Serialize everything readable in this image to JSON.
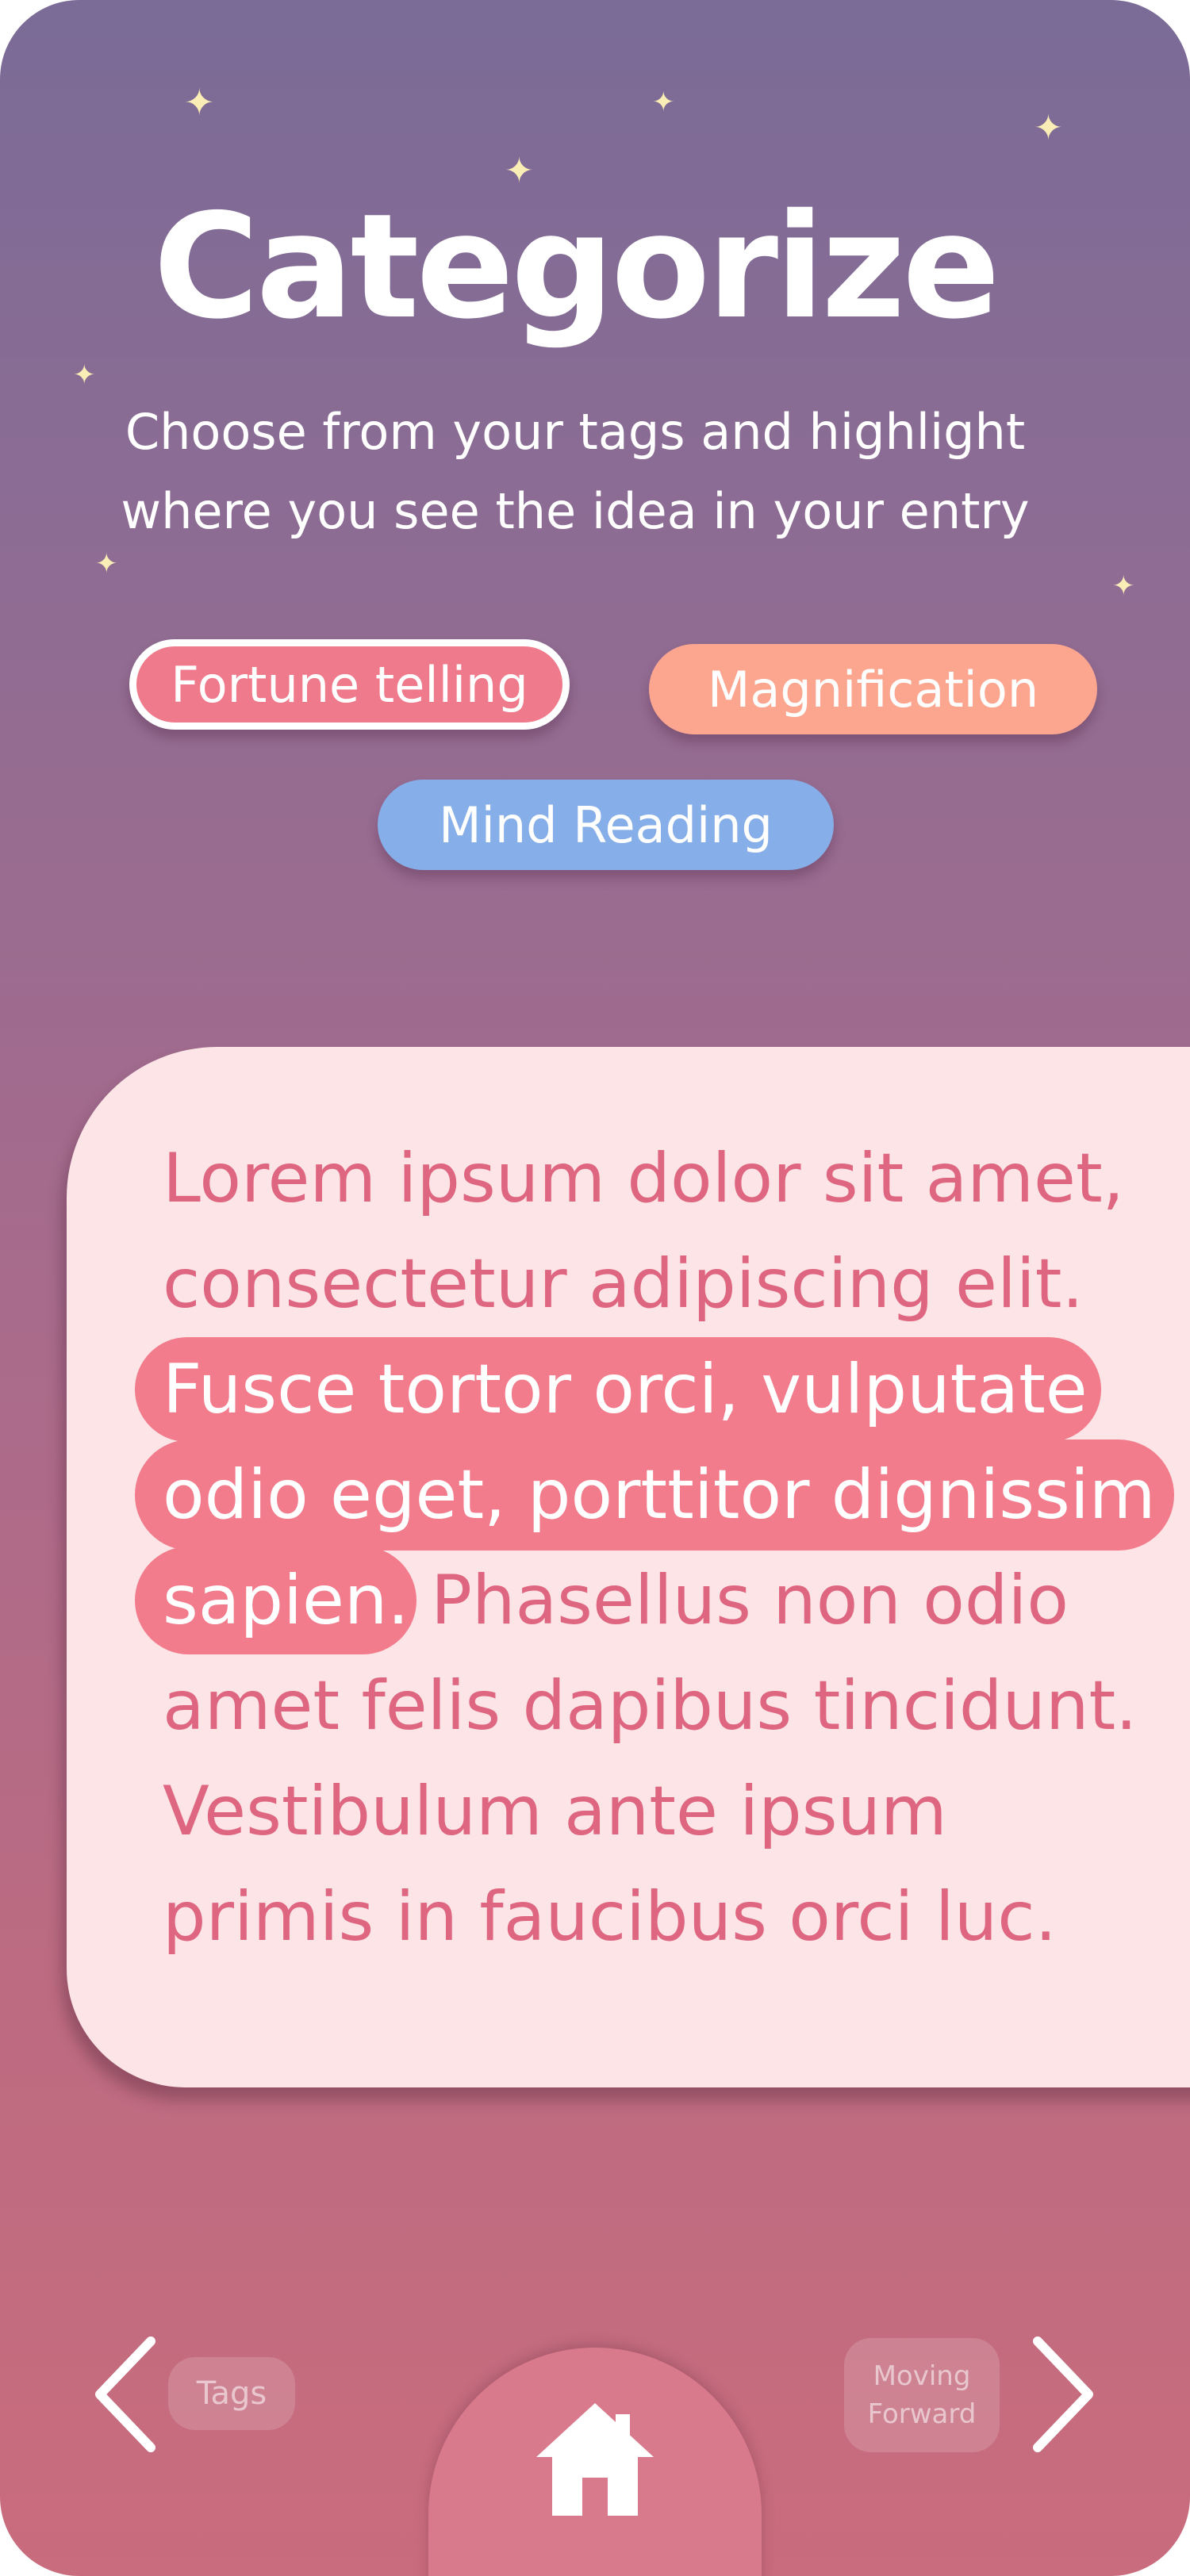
{
  "header": {
    "title": "Categorize",
    "subtitle_lines": [
      "Choose from your tags and highlight",
      "where you see the idea in your entry"
    ]
  },
  "tags": [
    {
      "label": "Fortune telling",
      "color": "#ef7a8b",
      "selected": true
    },
    {
      "label": "Magnification",
      "color": "#fca58f",
      "selected": false
    },
    {
      "label": "Mind Reading",
      "color": "#86aee8",
      "selected": false
    }
  ],
  "entry": {
    "lines": [
      {
        "before": "Lorem ipsum dolor sit amet,",
        "highlight": "",
        "after": ""
      },
      {
        "before": "consectetur adipiscing elit.",
        "highlight": "",
        "after": ""
      },
      {
        "before": "",
        "highlight": "Fusce tortor orci, vulputate",
        "after": ""
      },
      {
        "before": "",
        "highlight": "odio eget, porttitor dignissim",
        "after": ""
      },
      {
        "before": "",
        "highlight": "sapien.",
        "after": " Phasellus non odio"
      },
      {
        "before": "amet felis dapibus tincidunt.",
        "highlight": "",
        "after": ""
      },
      {
        "before": "Vestibulum ante ipsum",
        "highlight": "",
        "after": ""
      },
      {
        "before": "primis in faucibus orci luc.",
        "highlight": "",
        "after": ""
      }
    ],
    "highlight_color": "#f27b8c"
  },
  "nav": {
    "back_label": "Tags",
    "forward_label_lines": [
      "Moving",
      "Forward"
    ],
    "back_icon": "chevron-left-icon",
    "forward_icon": "chevron-right-icon",
    "home_icon": "home-icon"
  },
  "colors": {
    "background_top": "#7a6b97",
    "background_bottom": "#c96c7d",
    "card": "#fde4e6",
    "entry_text": "#df6680",
    "star": "#fbedb6"
  }
}
